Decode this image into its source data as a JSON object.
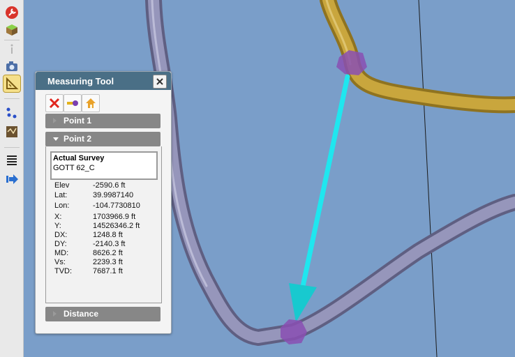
{
  "panel": {
    "title": "Measuring Tool",
    "point1_label": "Point 1",
    "point2_label": "Point 2",
    "distance_label": "Distance"
  },
  "point2": {
    "survey_type": "Actual Survey",
    "survey_name": "GOTT 62_C",
    "rows": [
      {
        "label": "Elev",
        "value": "-2590.6 ft"
      },
      {
        "label": "Lat:",
        "value": "39.9987140"
      },
      {
        "label": "Lon:",
        "value": "-104.7730810"
      },
      {
        "label": "X:",
        "value": "1703966.9 ft"
      },
      {
        "label": "Y:",
        "value": "14526346.2 ft"
      },
      {
        "label": "DX:",
        "value": "1248.8 ft"
      },
      {
        "label": "DY:",
        "value": "-2140.3 ft"
      },
      {
        "label": "MD:",
        "value": "8626.2 ft"
      },
      {
        "label": "Vs:",
        "value": "2239.3 ft"
      },
      {
        "label": "TVD:",
        "value": "7687.1 ft"
      }
    ]
  },
  "toolbar_icons": [
    "wrench-icon",
    "cube-icon",
    "info-icon",
    "camera-icon",
    "ruler-icon",
    "dots-icon",
    "map-icon",
    "list-icon",
    "arrow-icon"
  ],
  "colors": {
    "background": "#7a9ec9",
    "panel_header": "#4a6f86",
    "section_header": "#878787",
    "well_purple": "#8a8aae",
    "well_gold": "#c7a23a",
    "measure_line": "#1fe6ef"
  }
}
